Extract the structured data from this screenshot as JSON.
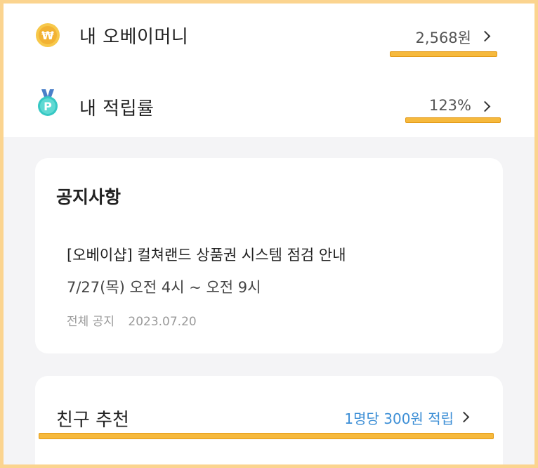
{
  "menu": {
    "money": {
      "label": "내 오베이머니",
      "value": "2,568원",
      "icon": "won-coin-icon"
    },
    "rate": {
      "label": "내 적립률",
      "value": "123%",
      "icon": "p-medal-icon"
    }
  },
  "notice": {
    "title": "공지사항",
    "item": {
      "line1": "[오베이샵] 컬쳐랜드 상품권 시스템 점검 안내",
      "line2": "7/27(목) 오전 4시 ~ 오전 9시",
      "category": "전체 공지",
      "date": "2023.07.20"
    }
  },
  "friend": {
    "label": "친구 추천",
    "value": "1명당 300원 적립"
  },
  "coin_symbol": "₩",
  "medal_symbol": "P",
  "colors": {
    "highlight": "#f6b93d",
    "frame": "#fbd48f",
    "link_blue": "#3d8fd6"
  }
}
